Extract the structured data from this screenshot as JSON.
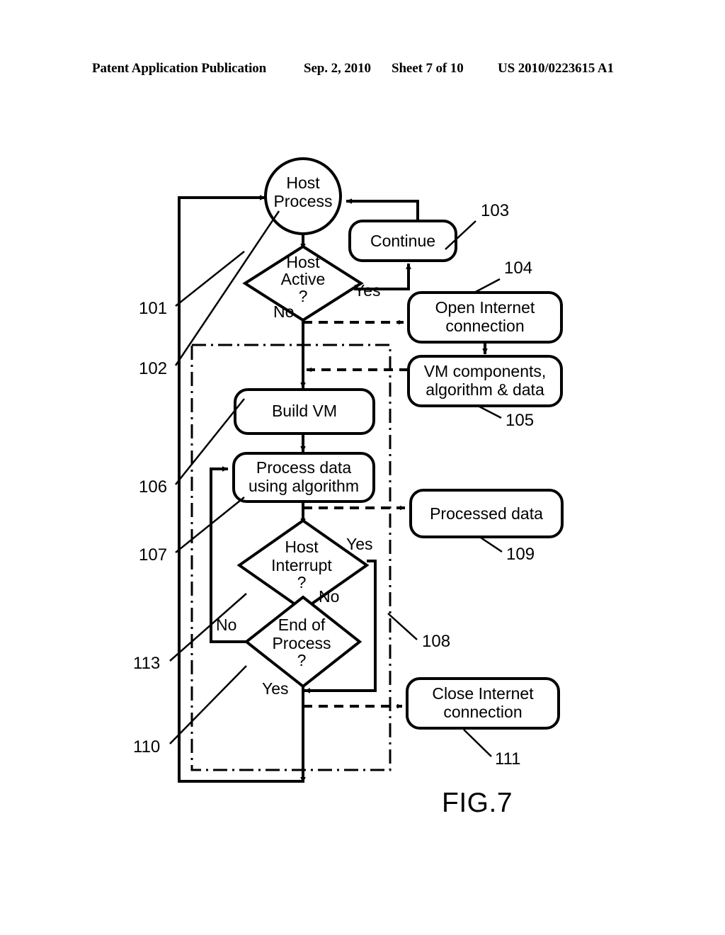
{
  "header": {
    "publication": "Patent Application Publication",
    "date": "Sep. 2, 2010",
    "sheet": "Sheet 7 of 10",
    "patent_number": "US 2010/0223615 A1"
  },
  "figure": {
    "caption": "FIG.7",
    "type": "flowchart",
    "line_color": "#000000",
    "background": "#ffffff"
  },
  "nodes": {
    "host_process": {
      "label_line1": "Host",
      "label_line2": "Process",
      "shape": "circle"
    },
    "host_active": {
      "label_line1": "Host",
      "label_line2": "Active",
      "label_line3": "?",
      "shape": "diamond"
    },
    "continue": {
      "label": "Continue",
      "shape": "rounded-rect"
    },
    "open_internet": {
      "label_line1": "Open Internet",
      "label_line2": "connection",
      "shape": "rounded-rect"
    },
    "vm_components": {
      "label_line1": "VM components,",
      "label_line2": "algorithm & data",
      "shape": "rounded-rect"
    },
    "build_vm": {
      "label": "Build VM",
      "shape": "rounded-rect"
    },
    "process_data": {
      "label_line1": "Process data",
      "label_line2": "using algorithm",
      "shape": "rounded-rect"
    },
    "host_interrupt": {
      "label_line1": "Host",
      "label_line2": "Interrupt",
      "label_line3": "?",
      "shape": "diamond"
    },
    "end_of_process": {
      "label_line1": "End of",
      "label_line2": "Process",
      "label_line3": "?",
      "shape": "diamond"
    },
    "processed_data": {
      "label": "Processed data",
      "shape": "rounded-rect"
    },
    "close_internet": {
      "label_line1": "Close Internet",
      "label_line2": "connection",
      "shape": "rounded-rect"
    }
  },
  "edge_labels": {
    "host_active_yes": "Yes",
    "host_active_no": "No",
    "host_interrupt_yes": "Yes",
    "host_interrupt_no": "No",
    "end_of_process_no": "No",
    "end_of_process_yes": "Yes"
  },
  "reference_numerals": {
    "n101": "101",
    "n102": "102",
    "n103": "103",
    "n104": "104",
    "n105": "105",
    "n106": "106",
    "n107": "107",
    "n108": "108",
    "n109": "109",
    "n110": "110",
    "n111": "111",
    "n113": "113"
  }
}
